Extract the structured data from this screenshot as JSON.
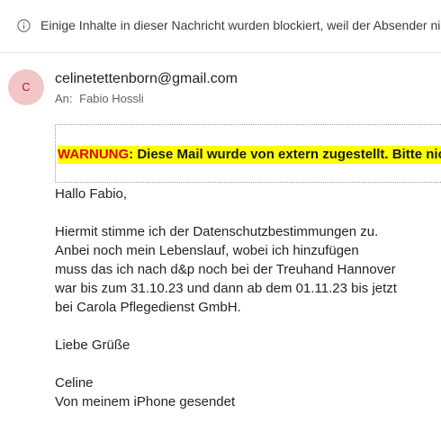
{
  "notice": {
    "text": "Einige Inhalte in dieser Nachricht wurden blockiert, weil der Absender nicht"
  },
  "header": {
    "avatar_initial": "C",
    "sender": "celinetettenborn@gmail.com",
    "to_label": "An:",
    "to_name": "Fabio Hossli"
  },
  "warning": {
    "label": "WARNUNG",
    "text": ": Diese Mail wurde von extern zugestellt. Bitte nicht"
  },
  "message": {
    "greeting": "Hallo Fabio,",
    "lines": [
      "Hiermit stimme ich der Datenschutzbestimmungen zu.",
      "Anbei noch mein Lebenslauf, wobei ich hinzufügen",
      "muss das ich nach d&p noch bei der Treuhand Hannover",
      "war bis zum 31.10.23 und dann ab dem 01.11.23 bis jetzt",
      "bei Carola Pflegedienst GmbH."
    ],
    "closing": "Liebe Grüße",
    "signature": "Celine",
    "footer": "Von meinem iPhone gesendet"
  }
}
